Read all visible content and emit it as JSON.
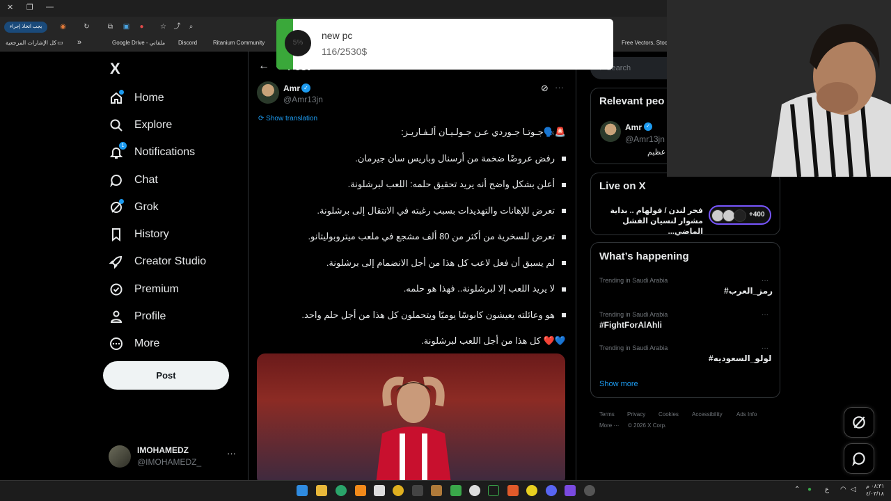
{
  "browser": {
    "action_button": "يجب اتخاذ إجراء",
    "bookmarks": [
      "كل الإشارات المرجعية",
      "Google Drive - ملفاتي",
      "Discord",
      "Ritanium Community",
      "Free Vectors, Stock..."
    ]
  },
  "toast": {
    "progress_label": "5%",
    "title": "new pc",
    "subtitle": "116/2530$",
    "progress": 0.05
  },
  "nav": {
    "logo": "X",
    "items": [
      {
        "label": "Home"
      },
      {
        "label": "Explore"
      },
      {
        "label": "Notifications",
        "badge": "1"
      },
      {
        "label": "Chat"
      },
      {
        "label": "Grok"
      },
      {
        "label": "History"
      },
      {
        "label": "Creator Studio"
      },
      {
        "label": "Premium"
      },
      {
        "label": "Profile"
      },
      {
        "label": "More"
      }
    ],
    "post_button": "Post",
    "account": {
      "name": "IMOHAMEDZ",
      "handle": "@IMOHAMEDZ_",
      "more": "···"
    }
  },
  "post": {
    "header_title": "Post",
    "author": {
      "name": "Amr",
      "handle": "@Amr13jn"
    },
    "more": "···",
    "show_translation": "Show translation",
    "lines": [
      "🚨🗣️جـوتـا جـوردي عـن جـولـيـان ألـفـاريـز:",
      "رفض عروضًا ضخمة من أرسنال وباريس سان جيرمان.",
      "أعلن بشكل واضح أنه يريد تحقيق حلمه: اللعب لبرشلونة.",
      "تعرض للإهانات والتهديدات بسبب رغبته في الانتقال إلى برشلونة.",
      "تعرض للسخرية من أكثر من 80 ألف مشجع في ملعب ميتروبوليتانو.",
      "لم يسبق أن فعل لاعب كل هذا من أجل الانضمام إلى برشلونة.",
      "لا يريد اللعب إلا لبرشلونة.. فهذا هو حلمه.",
      "هو وعائلته يعيشون كابوسًا يوميًا ويتحملون كل هذا من أجل حلم واحد.",
      "💙❤️ كل هذا من أجل اللعب لبرشلونة."
    ]
  },
  "right": {
    "search_placeholder": "Search",
    "relevant": {
      "title": "Relevant peo",
      "name": "Amr",
      "handle": "@Amr13jn",
      "bio": "عظيم"
    },
    "live": {
      "title": "Live on X",
      "text": "فخر لندن / فولهام .. بداية مشوار لنسيان الفشل الماضي...",
      "count": "+400"
    },
    "happening": {
      "title": "What’s happening",
      "trends": [
        {
          "meta": "Trending in Saudi Arabia",
          "name": "#رمز_العرب"
        },
        {
          "meta": "Trending in Saudi Arabia",
          "name": "#FightForAlAhli"
        },
        {
          "meta": "Trending in Saudi Arabia",
          "name": "#لولو_السعوديه"
        }
      ],
      "show_more": "Show more"
    },
    "footer": [
      "Terms",
      "Privacy",
      "Cookies",
      "Accessibility",
      "Ads Info",
      "More ···",
      "© 2026 X Corp."
    ]
  },
  "taskbar": {
    "lang": "ع",
    "time": "٠٨:٣١ م",
    "date": "٤/٠٣/١٨"
  },
  "colors": {
    "accent": "#1d9bf0",
    "background": "#000000",
    "toast_green": "#3aa83a"
  }
}
